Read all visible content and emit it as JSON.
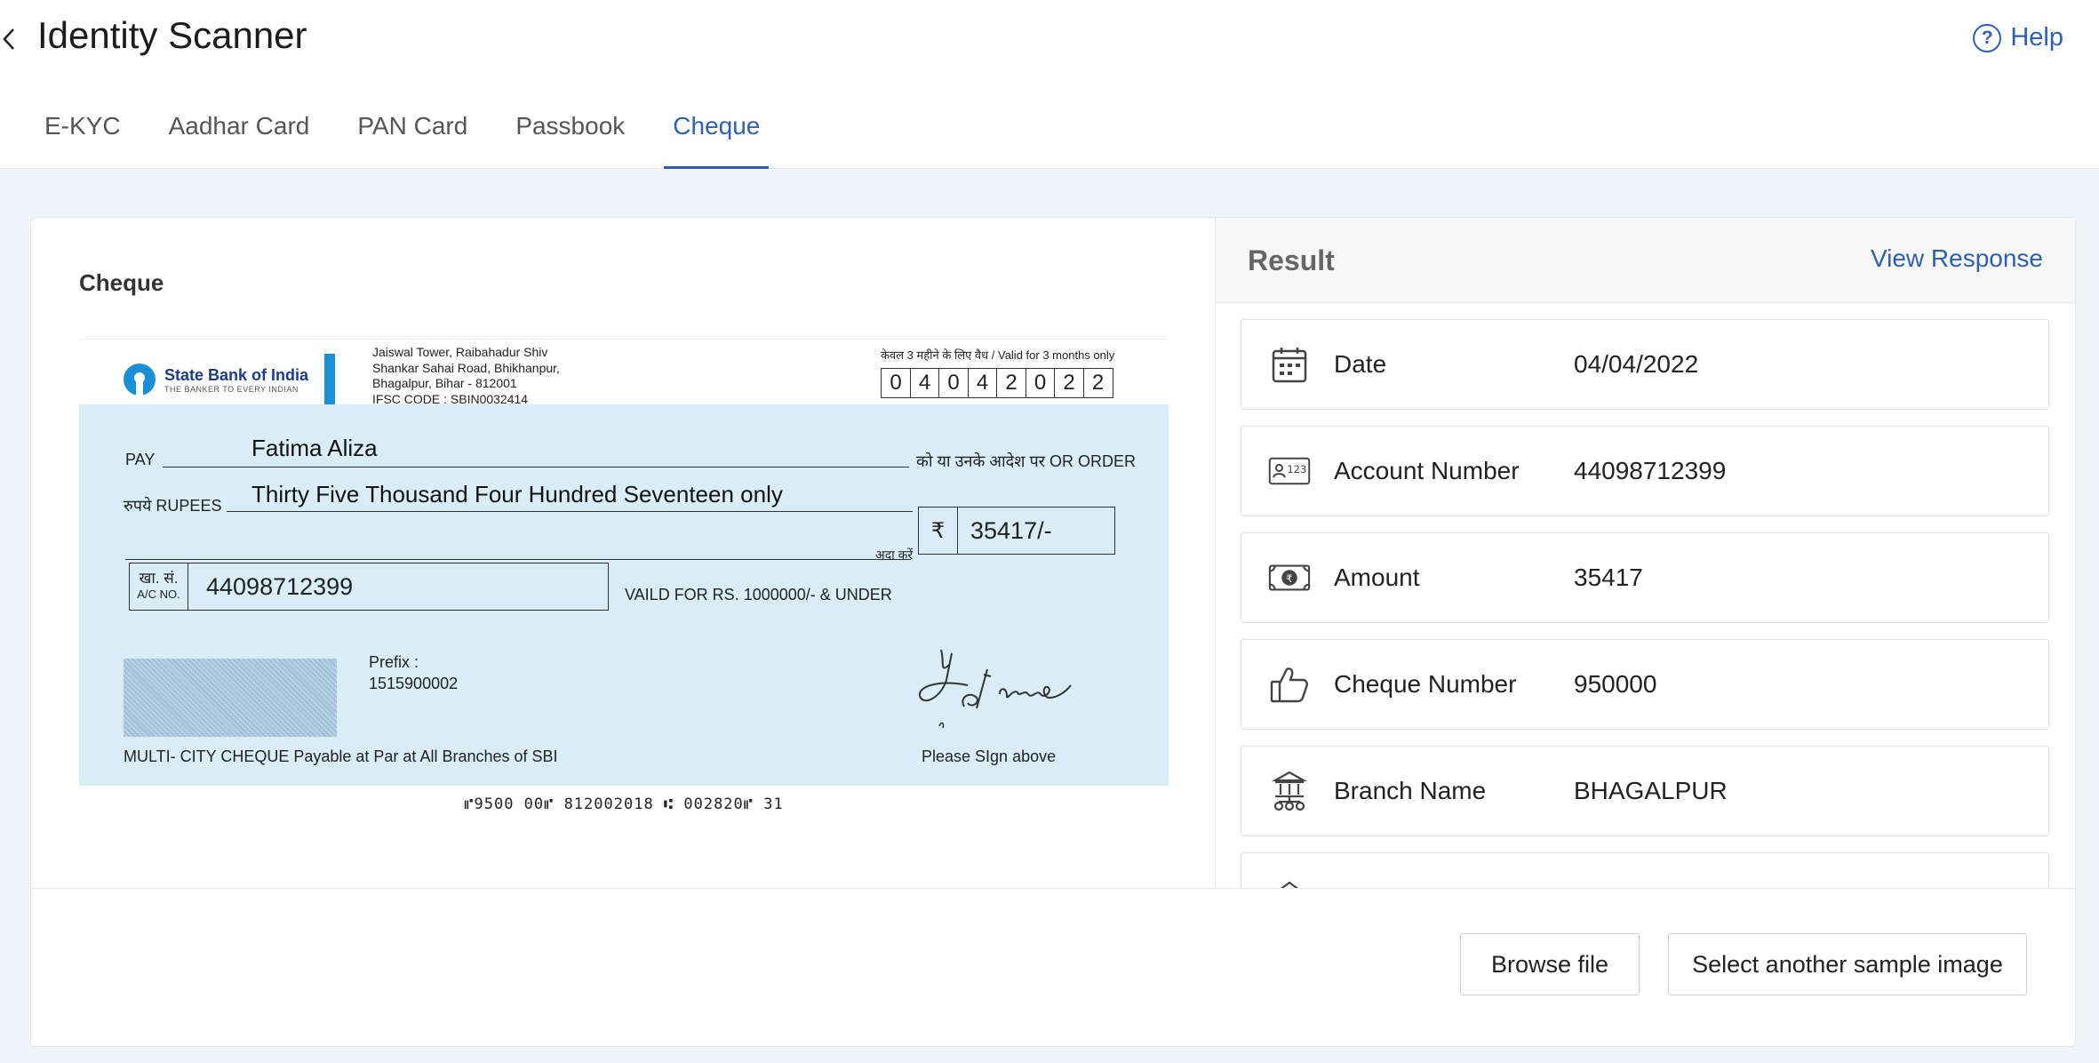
{
  "header": {
    "title": "Identity Scanner",
    "help_label": "Help"
  },
  "tabs": [
    {
      "label": "E-KYC",
      "active": false
    },
    {
      "label": "Aadhar Card",
      "active": false
    },
    {
      "label": "PAN Card",
      "active": false
    },
    {
      "label": "Passbook",
      "active": false
    },
    {
      "label": "Cheque",
      "active": true
    }
  ],
  "preview": {
    "label": "Cheque",
    "cheque": {
      "bank_name": "State Bank of India",
      "bank_tagline": "THE BANKER TO EVERY INDIAN",
      "address_lines": [
        "Jaiswal Tower, Raibahadur Shiv",
        "Shankar Sahai Road, Bhikhanpur,",
        "Bhagalpur, Bihar - 812001",
        "IFSC CODE : SBIN0032414"
      ],
      "validity_text": "केवल 3 महीने के लिए वैध / Valid for 3 months only",
      "date_digits": [
        "0",
        "4",
        "0",
        "4",
        "2",
        "0",
        "2",
        "2"
      ],
      "pay_label": "PAY",
      "payee": "Fatima Aliza",
      "or_order": "को या उनके आदेश पर  OR ORDER",
      "rupees_label": "रुपये RUPEES",
      "amount_words": "Thirty Five Thousand Four Hundred Seventeen only",
      "ada_karen": "अदा करें",
      "rupee_symbol": "₹",
      "amount_figure": "35417/-",
      "ac_label_hi": "खा. सं.",
      "ac_label_en": "A/C NO.",
      "account_number": "44098712399",
      "valid_limit": "VAILD FOR RS. 1000000/- & UNDER",
      "prefix_label": "Prefix :",
      "prefix_value": "1515900002",
      "multicity": "MULTI- CITY CHEQUE Payable at Par at All Branches of SBI",
      "sign_above": "Please SIgn above",
      "micr": "⑈9500 00⑈  812002018 ⑆ 002820⑈ 31"
    }
  },
  "result": {
    "title": "Result",
    "view_response": "View Response",
    "rows": [
      {
        "icon": "calendar-icon",
        "label": "Date",
        "value": "04/04/2022"
      },
      {
        "icon": "account-card-icon",
        "label": "Account Number",
        "value": "44098712399"
      },
      {
        "icon": "banknote-icon",
        "label": "Amount",
        "value": "35417"
      },
      {
        "icon": "thumbs-up-icon",
        "label": "Cheque Number",
        "value": "950000"
      },
      {
        "icon": "bank-branch-icon",
        "label": "Branch Name",
        "value": "BHAGALPUR"
      }
    ]
  },
  "footer": {
    "browse_label": "Browse file",
    "sample_label": "Select another sample image"
  }
}
